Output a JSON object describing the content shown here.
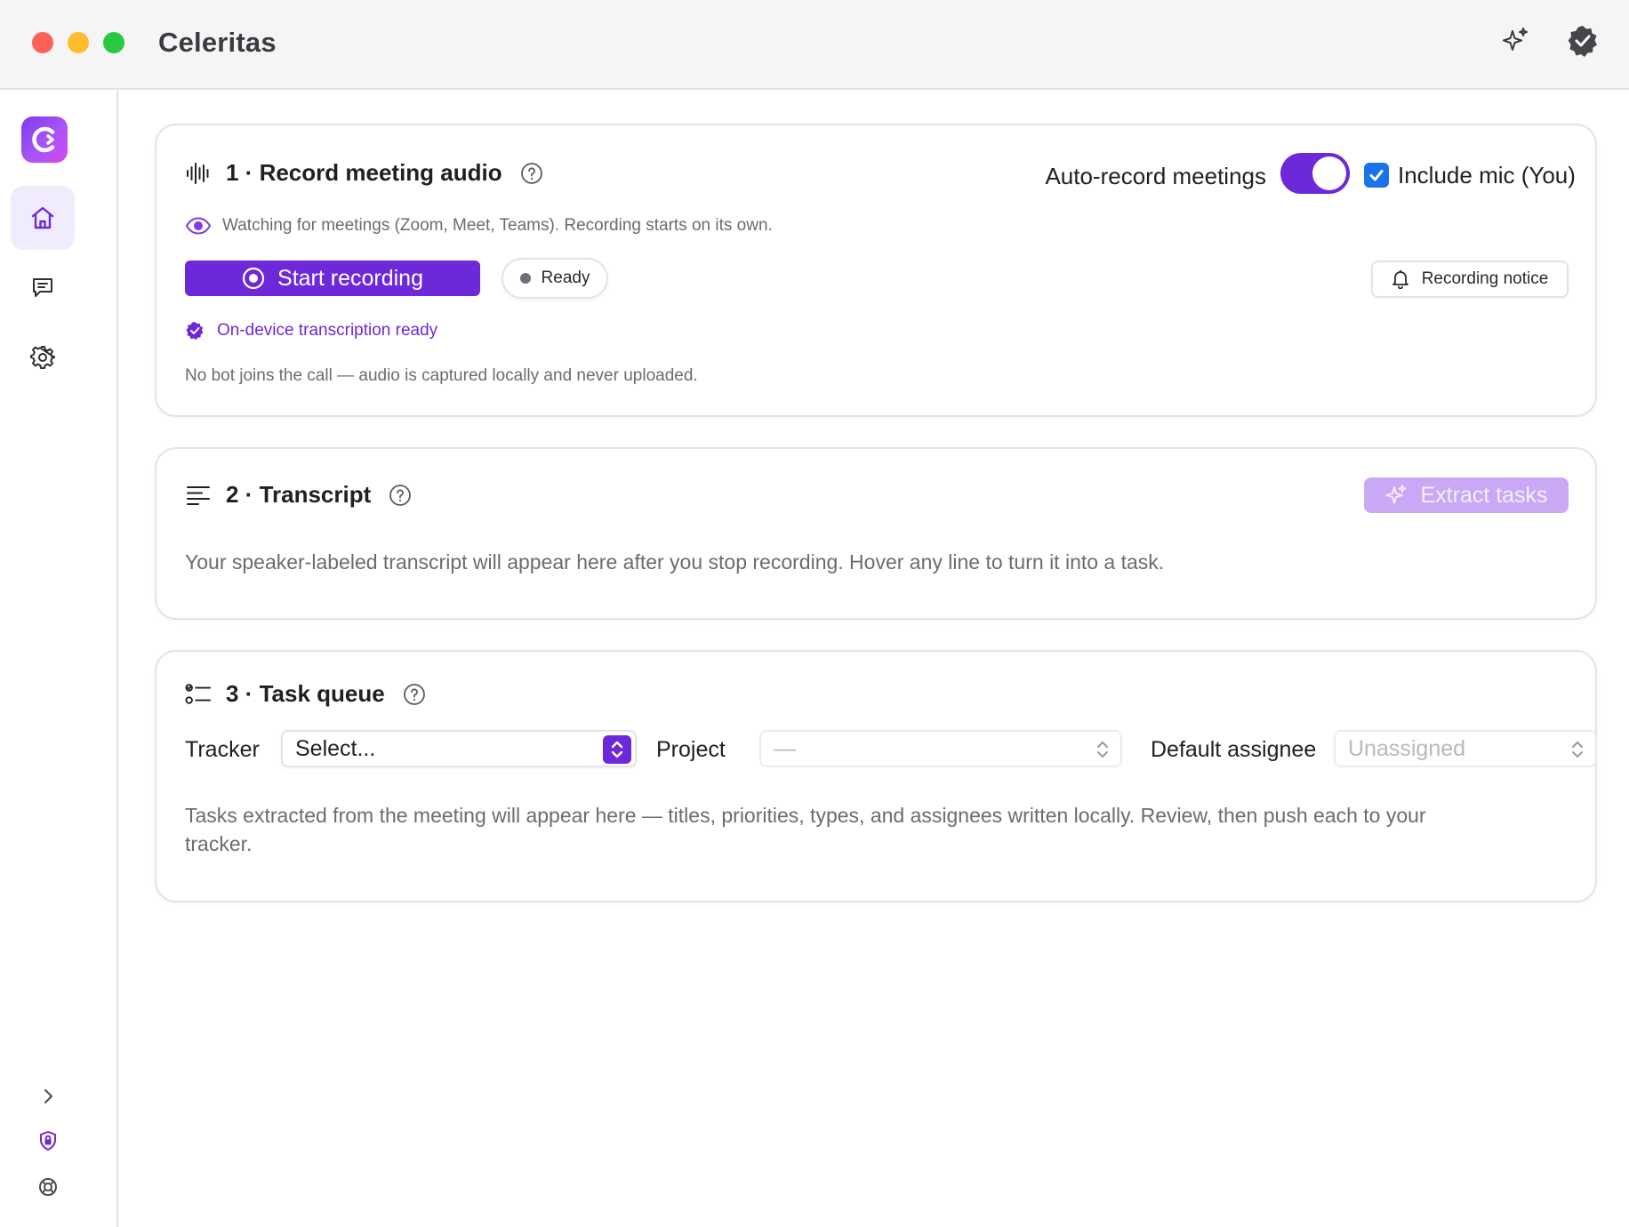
{
  "window": {
    "title": "Celeritas"
  },
  "sidebar": {
    "items": [
      {
        "name": "home",
        "icon": "home-icon",
        "active": true
      },
      {
        "name": "messages",
        "icon": "chat-icon",
        "active": false
      },
      {
        "name": "settings",
        "icon": "gear-icon",
        "active": false
      }
    ],
    "bottom": [
      {
        "name": "expand",
        "icon": "chevron-right-icon"
      },
      {
        "name": "privacy",
        "icon": "shield-lock-icon"
      },
      {
        "name": "support",
        "icon": "lifebuoy-icon"
      }
    ]
  },
  "record": {
    "title": "1 · Record meeting audio",
    "auto_record_label": "Auto-record meetings",
    "auto_record_on": true,
    "include_mic_label": "Include mic (You)",
    "include_mic_checked": true,
    "watching_text": "Watching for meetings (Zoom, Meet, Teams). Recording starts on its own.",
    "start_label": "Start recording",
    "status_label": "Ready",
    "notice_label": "Recording notice",
    "ondevice_text": "On-device transcription ready",
    "privacy_text": "No bot joins the call — audio is captured locally and never uploaded."
  },
  "transcript": {
    "title": "2 · Transcript",
    "extract_label": "Extract tasks",
    "extract_enabled": false,
    "empty_text": "Your speaker-labeled transcript will appear here after you stop recording. Hover any line to turn it into a task."
  },
  "tasks": {
    "title": "3 · Task queue",
    "tracker_label": "Tracker",
    "tracker_value": "Select...",
    "project_label": "Project",
    "project_value": "—",
    "assignee_label": "Default assignee",
    "assignee_value": "Unassigned",
    "empty_text": "Tasks extracted from the meeting will appear here — titles, priorities, types, and assignees written locally. Review, then push each to your tracker."
  },
  "colors": {
    "accent": "#6d28d9",
    "accent_disabled": "#c9a8f5",
    "checkbox": "#1a73e8"
  }
}
